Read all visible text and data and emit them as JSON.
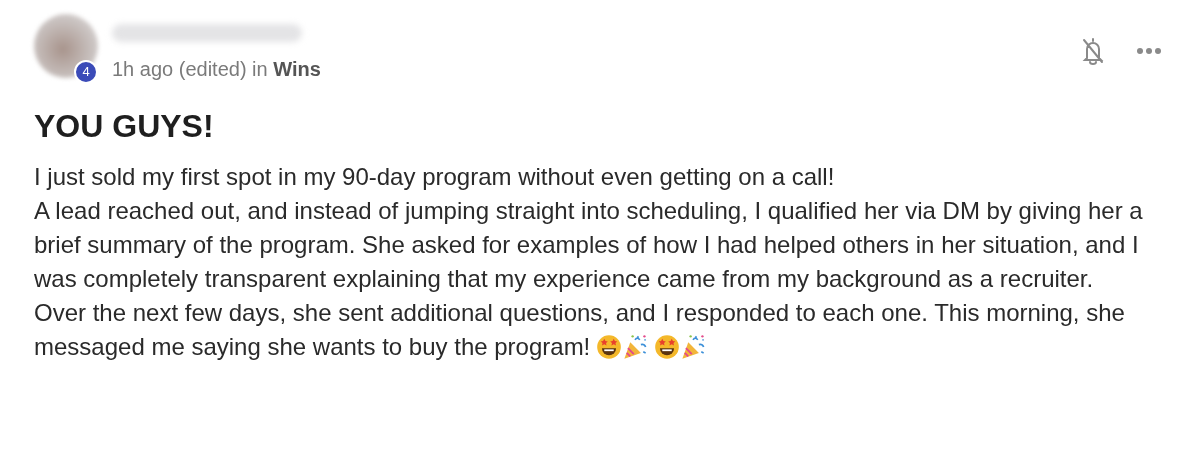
{
  "post": {
    "author_level": "4",
    "meta": "1h ago (edited) in **Wins**",
    "title": "YOU GUYS!",
    "paragraphs": [
      "I just sold my first spot in my 90-day program without even getting on a call!",
      "A lead reached out, and instead of jumping straight into scheduling, I qualified her via DM by giving her a brief summary of the program. She asked for examples of how I had helped others in her situation, and I was completely transparent explaining that my experience came from my background as a recruiter.",
      "Over the next few days, she sent additional questions, and I responded to each one. This morning, she"
    ],
    "closing_line": "messaged me saying she wants to buy the program!",
    "emojis": [
      {
        "kind": "star-struck"
      },
      {
        "kind": "party-popper"
      },
      {
        "kind": "star-struck"
      },
      {
        "kind": "party-popper"
      }
    ]
  }
}
